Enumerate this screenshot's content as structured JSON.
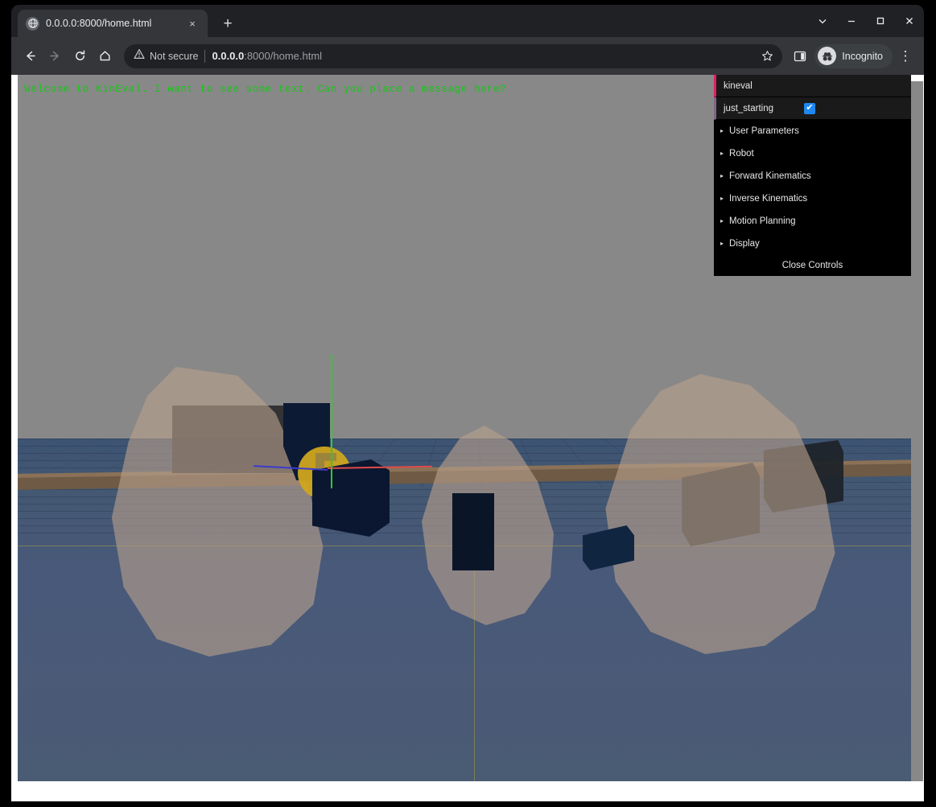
{
  "browser": {
    "tab": {
      "title": "0.0.0.0:8000/home.html",
      "favicon": "globe-icon",
      "close": "×",
      "new_tab": "+"
    },
    "window_controls": {
      "chevron": "⌄",
      "minimize": "–",
      "maximize": "☐",
      "close": "✕"
    },
    "nav": {
      "back": "←",
      "forward": "→",
      "reload": "↻",
      "home": "⌂"
    },
    "omnibox": {
      "security_label": "Not secure",
      "url_host": "0.0.0.0",
      "url_path": ":8000/home.html",
      "full_url": "0.0.0.0:8000/home.html",
      "star": "☆"
    },
    "toolbar": {
      "side_panel": "side-panel-icon",
      "incognito_label": "Incognito",
      "menu": "⋮"
    }
  },
  "page": {
    "overlay_message": "Welcome to KinEval. I want to see some text. Can you place a message here?",
    "overlay_color": "#14c814"
  },
  "controls": {
    "title": "kineval",
    "property": {
      "label": "just_starting",
      "checked": true,
      "check_glyph": "✔"
    },
    "folders": [
      {
        "label": "User Parameters",
        "caret": "▸",
        "expanded": false
      },
      {
        "label": "Robot",
        "caret": "▸",
        "expanded": false
      },
      {
        "label": "Forward Kinematics",
        "caret": "▸",
        "expanded": false
      },
      {
        "label": "Inverse Kinematics",
        "caret": "▸",
        "expanded": false
      },
      {
        "label": "Motion Planning",
        "caret": "▸",
        "expanded": false
      },
      {
        "label": "Display",
        "caret": "▸",
        "expanded": false
      }
    ],
    "close_label": "Close Controls",
    "accent_title": "#e61d5f",
    "accent_property": "#806787",
    "checkbox_color": "#1e88ef"
  },
  "scene": {
    "sky_color": "#888888",
    "ground_color": "#435872",
    "rock_color": "#b8a08c",
    "box_color": "#0b1730",
    "beam_color": "#6e5a45",
    "joint_color": "#cfa51f",
    "axis_x_color": "#e04a4a",
    "axis_y_color": "#2ecc2e",
    "axis_z_color": "#3a3ad0",
    "grid_line_color": "#8b8b4e"
  }
}
